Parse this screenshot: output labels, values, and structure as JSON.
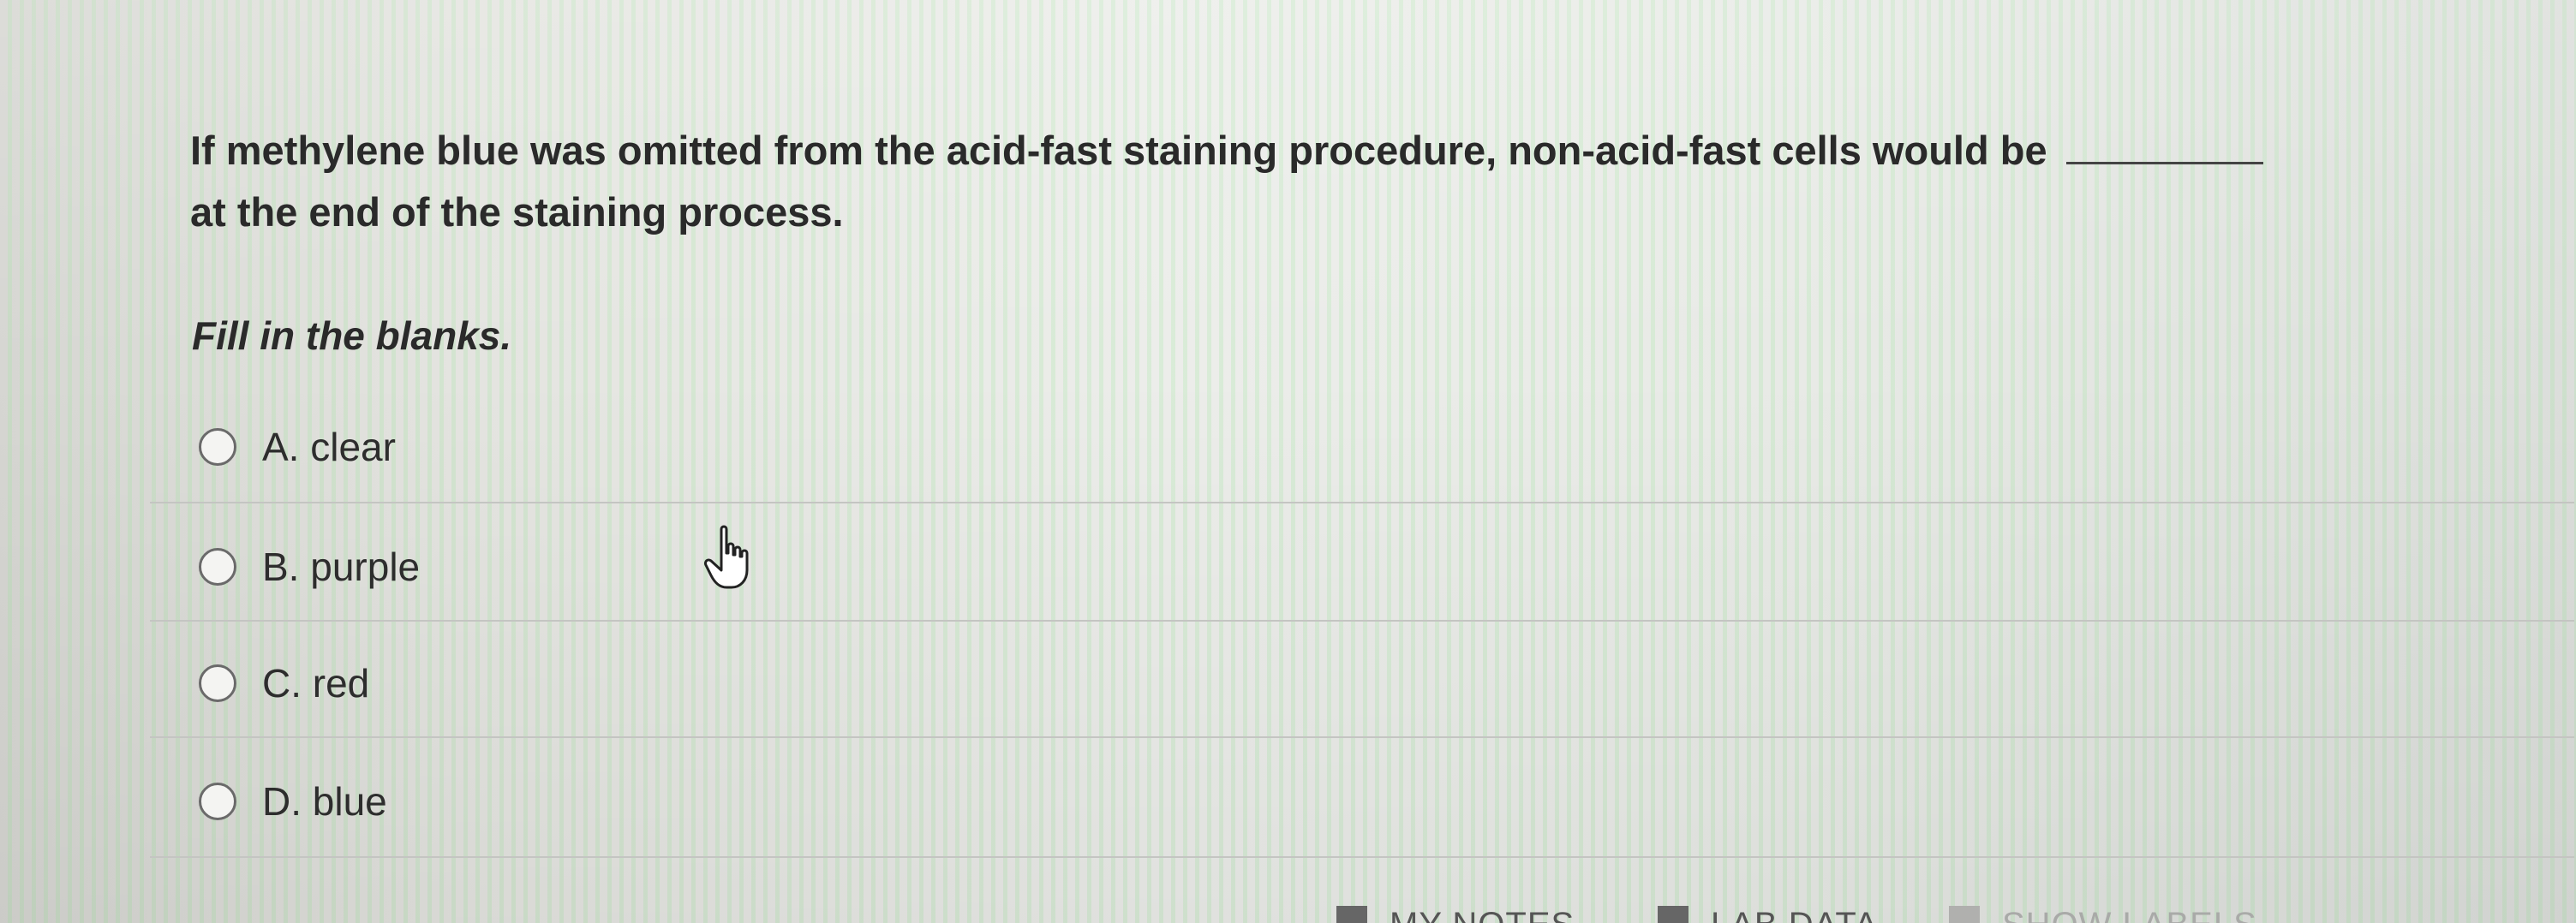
{
  "question": {
    "text": "If methylene blue was omitted from the acid-fast staining procedure, non-acid-fast cells would be",
    "continuation": "at the end of the staining process."
  },
  "instruction": "Fill in the blanks.",
  "options": [
    {
      "letter": "A.",
      "text": "clear"
    },
    {
      "letter": "B.",
      "text": "purple"
    },
    {
      "letter": "C.",
      "text": "red"
    },
    {
      "letter": "D.",
      "text": "blue"
    }
  ],
  "toolbar": {
    "my_notes": "MY NOTES",
    "lab_data": "LAB DATA",
    "show_labels": "SHOW LABELS"
  },
  "icons": {
    "cursor": "pointer-hand-icon",
    "radio": "radio-button-icon"
  }
}
